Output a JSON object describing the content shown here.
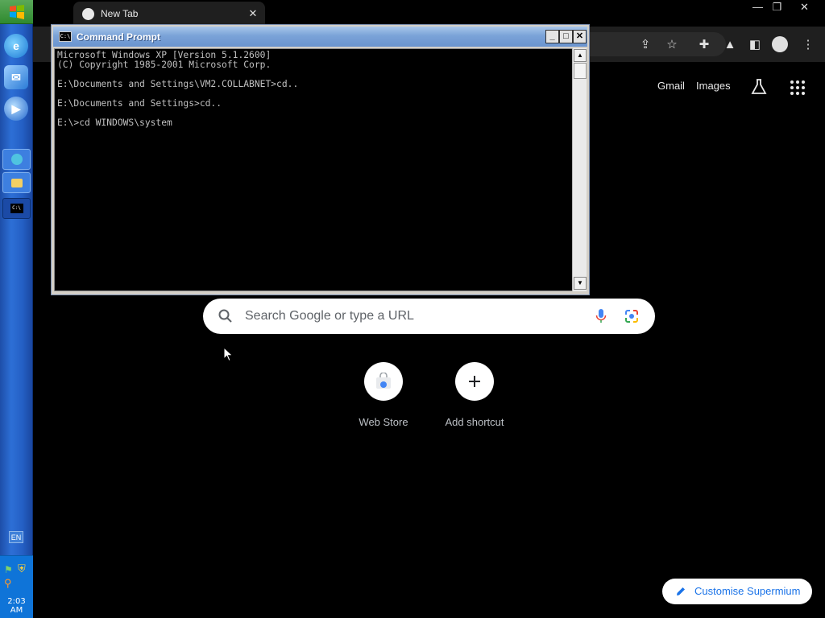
{
  "taskbar": {
    "start_icon": "windows-flag-icon",
    "quick_launch": [
      "internet-explorer-icon",
      "outlook-express-icon",
      "media-player-icon"
    ],
    "tasks": [
      "browser-task-icon",
      "folder-task-icon",
      "cmd-task-icon"
    ],
    "language": "EN",
    "clock": "2:03 AM",
    "colors": {
      "bar": "#245fc4",
      "tray": "#0f74d8",
      "start": "#3a963a"
    }
  },
  "browser": {
    "tab_title": "New Tab",
    "links": {
      "gmail": "Gmail",
      "images": "Images"
    },
    "search_placeholder": "Search Google or type a URL",
    "shortcuts": [
      {
        "label": "Web Store",
        "icon": "web-store-icon"
      },
      {
        "label": "Add shortcut",
        "icon": "plus-icon"
      }
    ],
    "customise_label": "Customise Supermium"
  },
  "cmd": {
    "title": "Command Prompt",
    "icon_text": "C:\\",
    "lines": [
      "Microsoft Windows XP [Version 5.1.2600]",
      "(C) Copyright 1985-2001 Microsoft Corp.",
      "",
      "E:\\Documents and Settings\\VM2.COLLABNET>cd..",
      "",
      "E:\\Documents and Settings>cd..",
      "",
      "E:\\>cd WINDOWS\\system"
    ],
    "colors": {
      "text": "#c0c0c0",
      "background": "#000000",
      "title_bar": "#7ba3d8"
    }
  }
}
